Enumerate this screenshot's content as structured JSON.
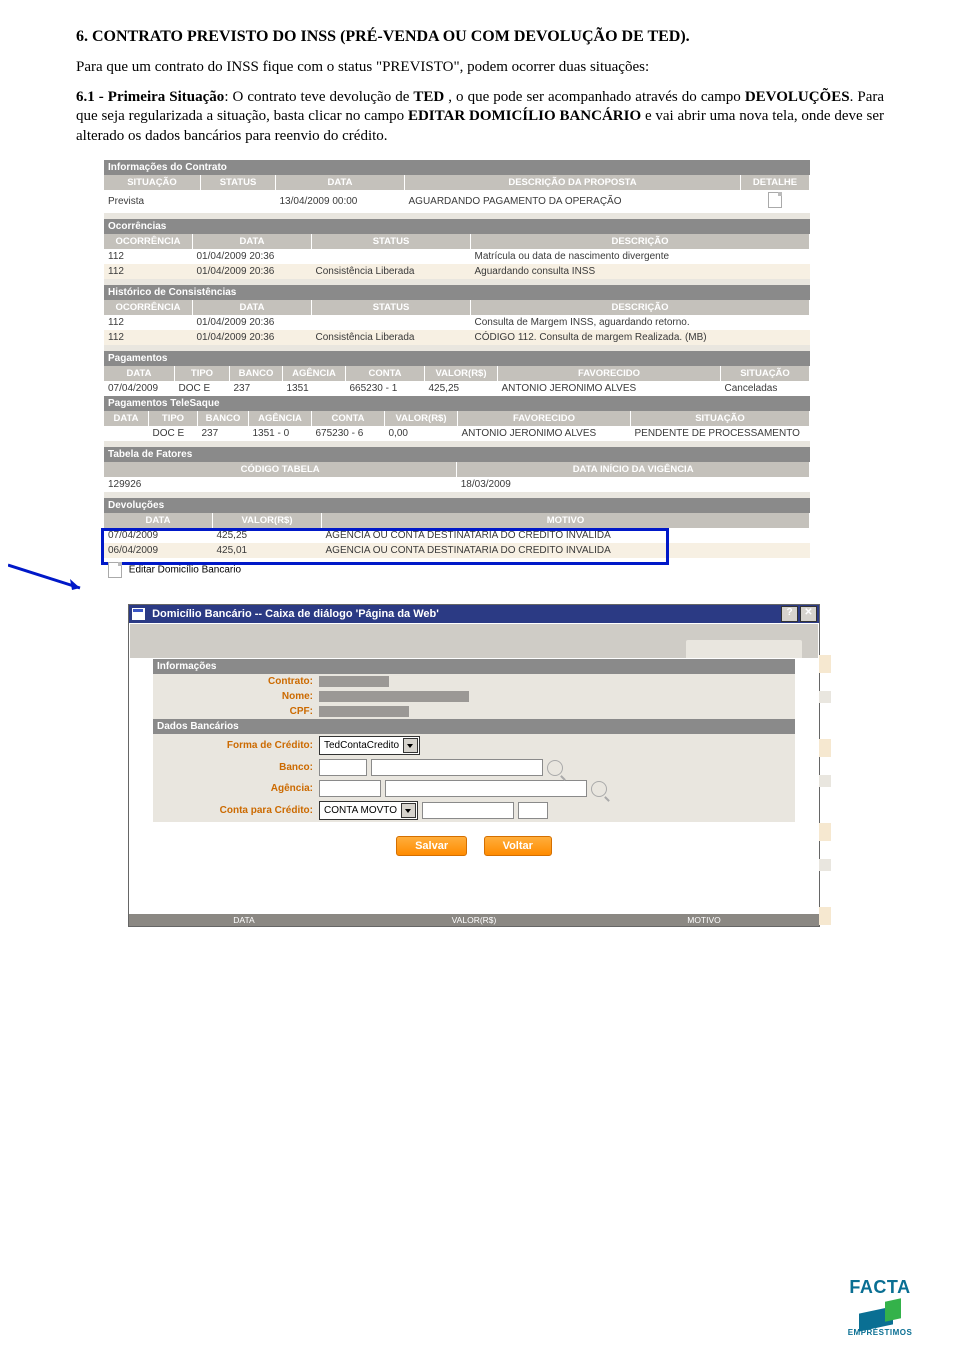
{
  "text": {
    "heading": "6.  CONTRATO PREVISTO DO INSS (PRÉ-VENDA OU COM DEVOLUÇÃO DE TED).",
    "p1": "Para que um contrato do INSS fique com o status \"PREVISTO\", podem ocorrer duas situações:",
    "p2_prefix": "6.1 - Primeira Situação",
    "p2_body": ": O contrato teve devolução de ",
    "p2_ted": "TED",
    "p2_body2": " , o que pode ser acompanhado através do campo ",
    "p2_dev": "DEVOLUÇÕES",
    "p2_body3": ". Para que seja regularizada a situação, basta clicar no campo ",
    "p2_edit": "EDITAR DOMICÍLIO BANCÁRIO",
    "p2_body4": " e vai abrir uma nova tela, onde deve ser alterado os dados bancários para reenvio do crédito."
  },
  "info_contrato": {
    "bar": "Informações do Contrato",
    "hdr": {
      "situacao": "SITUAÇÃO",
      "status": "STATUS",
      "data": "DATA",
      "descricao": "DESCRIÇÃO DA PROPOSTA",
      "detalhe": "DETALHE"
    },
    "row": {
      "situacao": "Prevista",
      "status": "",
      "data": "13/04/2009 00:00",
      "descricao": "AGUARDANDO PAGAMENTO DA OPERAÇÃO"
    }
  },
  "ocorrencias": {
    "bar": "Ocorrências",
    "hdr": {
      "oc": "OCORRÊNCIA",
      "data": "DATA",
      "status": "STATUS",
      "desc": "DESCRIÇÃO"
    },
    "rows": [
      {
        "oc": "112",
        "data": "01/04/2009 20:36",
        "status": "",
        "desc": "Matrícula ou data de nascimento divergente"
      },
      {
        "oc": "112",
        "data": "01/04/2009 20:36",
        "status": "Consistência Liberada",
        "desc": "Aguardando consulta INSS"
      }
    ]
  },
  "historico": {
    "bar": "Histórico de Consistências",
    "hdr": {
      "oc": "OCORRÊNCIA",
      "data": "DATA",
      "status": "STATUS",
      "desc": "DESCRIÇÃO"
    },
    "rows": [
      {
        "oc": "112",
        "data": "01/04/2009 20:36",
        "status": "",
        "desc": "Consulta de Margem INSS, aguardando retorno."
      },
      {
        "oc": "112",
        "data": "01/04/2009 20:36",
        "status": "Consistência Liberada",
        "desc": "CÓDIGO 112. Consulta de margem Realizada. (MB)"
      }
    ]
  },
  "pagamentos": {
    "bar": "Pagamentos",
    "hdr": {
      "data": "DATA",
      "tipo": "TIPO",
      "banco": "BANCO",
      "agencia": "AGÊNCIA",
      "conta": "CONTA",
      "valor": "VALOR(R$)",
      "fav": "FAVORECIDO",
      "sit": "SITUAÇÃO"
    },
    "rows": [
      {
        "data": "07/04/2009",
        "tipo": "DOC E",
        "banco": "237",
        "agencia": "1351",
        "conta": "665230 - 1",
        "valor": "425,25",
        "fav": "ANTONIO JERONIMO ALVES",
        "sit": "Canceladas"
      }
    ]
  },
  "telesaque": {
    "bar": "Pagamentos TeleSaque",
    "hdr": {
      "data": "DATA",
      "tipo": "TIPO",
      "banco": "BANCO",
      "agencia": "AGÊNCIA",
      "conta": "CONTA",
      "valor": "VALOR(R$)",
      "fav": "FAVORECIDO",
      "sit": "SITUAÇÃO"
    },
    "rows": [
      {
        "data": "",
        "tipo": "DOC E",
        "banco": "237",
        "agencia": "1351 - 0",
        "conta": "675230 - 6",
        "valor": "0,00",
        "fav": "ANTONIO JERONIMO ALVES",
        "sit": "PENDENTE DE PROCESSAMENTO"
      }
    ]
  },
  "tabela_fatores": {
    "bar": "Tabela de Fatores",
    "hdr": {
      "cod": "CÓDIGO TABELA",
      "vig": "DATA INÍCIO DA VIGÊNCIA"
    },
    "row": {
      "cod": "129926",
      "vig": "18/03/2009"
    }
  },
  "devolucoes": {
    "bar": "Devoluções",
    "hdr": {
      "data": "DATA",
      "valor": "VALOR(R$)",
      "motivo": "MOTIVO"
    },
    "rows": [
      {
        "data": "07/04/2009",
        "valor": "425,25",
        "motivo": "AGENCIA OU CONTA DESTINATARIA DO CREDITO INVALIDA"
      },
      {
        "data": "06/04/2009",
        "valor": "425,01",
        "motivo": "AGENCIA OU CONTA DESTINATARIA DO CREDITO INVALIDA"
      }
    ]
  },
  "editar": {
    "label": "Editar Domicílio Bancario"
  },
  "dialog": {
    "title": "Domicílio Bancário -- Caixa de diálogo 'Página da Web'",
    "informacoes": {
      "bar": "Informações",
      "contrato": "Contrato:",
      "nome": "Nome:",
      "cpf": "CPF:"
    },
    "dados": {
      "bar": "Dados Bancários",
      "forma": "Forma de Crédito:",
      "forma_val": "TedContaCredito",
      "banco": "Banco:",
      "agencia": "Agência:",
      "conta": "Conta para Crédito:",
      "conta_val": "CONTA MOVTO"
    },
    "btn_salvar": "Salvar",
    "btn_voltar": "Voltar",
    "footer": {
      "a": "DATA",
      "b": "VALOR(R$)",
      "c": "MOTIVO"
    }
  },
  "logo": {
    "name": "FACTA",
    "sub": "EMPRÉSTIMOS"
  }
}
